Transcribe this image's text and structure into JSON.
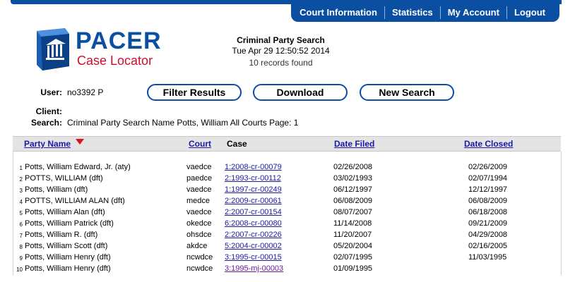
{
  "nav": {
    "items": [
      "Court Information",
      "Statistics",
      "My Account",
      "Logout"
    ]
  },
  "logo": {
    "title": "PACER",
    "subtitle": "Case Locator"
  },
  "header": {
    "title": "Criminal Party Search",
    "datetime": "Tue Apr 29 12:50:52 2014",
    "records": "10 records found"
  },
  "info": {
    "user_label": "User:",
    "user_value": "no3392 P",
    "client_label": "Client:",
    "client_value": "",
    "search_label": "Search:",
    "search_value": "Criminal Party Search Name Potts, William All Courts Page: 1"
  },
  "buttons": {
    "filter": "Filter Results",
    "download": "Download",
    "new_search": "New Search"
  },
  "table": {
    "columns": {
      "party": "Party Name",
      "court": "Court",
      "case": "Case",
      "filed": "Date Filed",
      "closed": "Date Closed"
    },
    "rows": [
      {
        "num": "1",
        "party": "Potts, William Edward, Jr. (aty)",
        "court": "vaedce",
        "case": "1:2008-cr-00079",
        "filed": "02/26/2008",
        "closed": "02/26/2009"
      },
      {
        "num": "2",
        "party": "POTTS, WILLIAM (dft)",
        "court": "paedce",
        "case": "2:1993-cr-00112",
        "filed": "03/02/1993",
        "closed": "02/07/1994"
      },
      {
        "num": "3",
        "party": "Potts, William (dft)",
        "court": "vaedce",
        "case": "1:1997-cr-00249",
        "filed": "06/12/1997",
        "closed": "12/12/1997"
      },
      {
        "num": "4",
        "party": "POTTS, WILLIAM ALAN (dft)",
        "court": "medce",
        "case": "2:2009-cr-00061",
        "filed": "06/08/2009",
        "closed": "06/08/2009"
      },
      {
        "num": "5",
        "party": "Potts, William Alan (dft)",
        "court": "vaedce",
        "case": "2:2007-cr-00154",
        "filed": "08/07/2007",
        "closed": "06/18/2008"
      },
      {
        "num": "6",
        "party": "Potts, William Patrick (dft)",
        "court": "okedce",
        "case": "6:2008-cr-00080",
        "filed": "11/14/2008",
        "closed": "09/21/2009"
      },
      {
        "num": "7",
        "party": "Potts, William R. (dft)",
        "court": "ohsdce",
        "case": "2:2007-cr-00226",
        "filed": "11/20/2007",
        "closed": "04/29/2008"
      },
      {
        "num": "8",
        "party": "Potts, William Scott (dft)",
        "court": "akdce",
        "case": "5:2004-cr-00002",
        "filed": "05/20/2004",
        "closed": "02/16/2005"
      },
      {
        "num": "9",
        "party": "Potts, William Henry (dft)",
        "court": "ncwdce",
        "case": "3:1995-cr-00015",
        "filed": "02/07/1995",
        "closed": "11/03/1995"
      },
      {
        "num": "10",
        "party": "Potts, William Henry (dft)",
        "court": "ncwdce",
        "case": "3:1995-mj-00003",
        "filed": "01/09/1995",
        "closed": ""
      }
    ]
  },
  "colors": {
    "brand_blue": "#0b4fa3",
    "brand_red": "#c8102e",
    "link": "#1a1aa6",
    "visited_link": "#6a1b9a",
    "sort_arrow": "#d7141a"
  }
}
